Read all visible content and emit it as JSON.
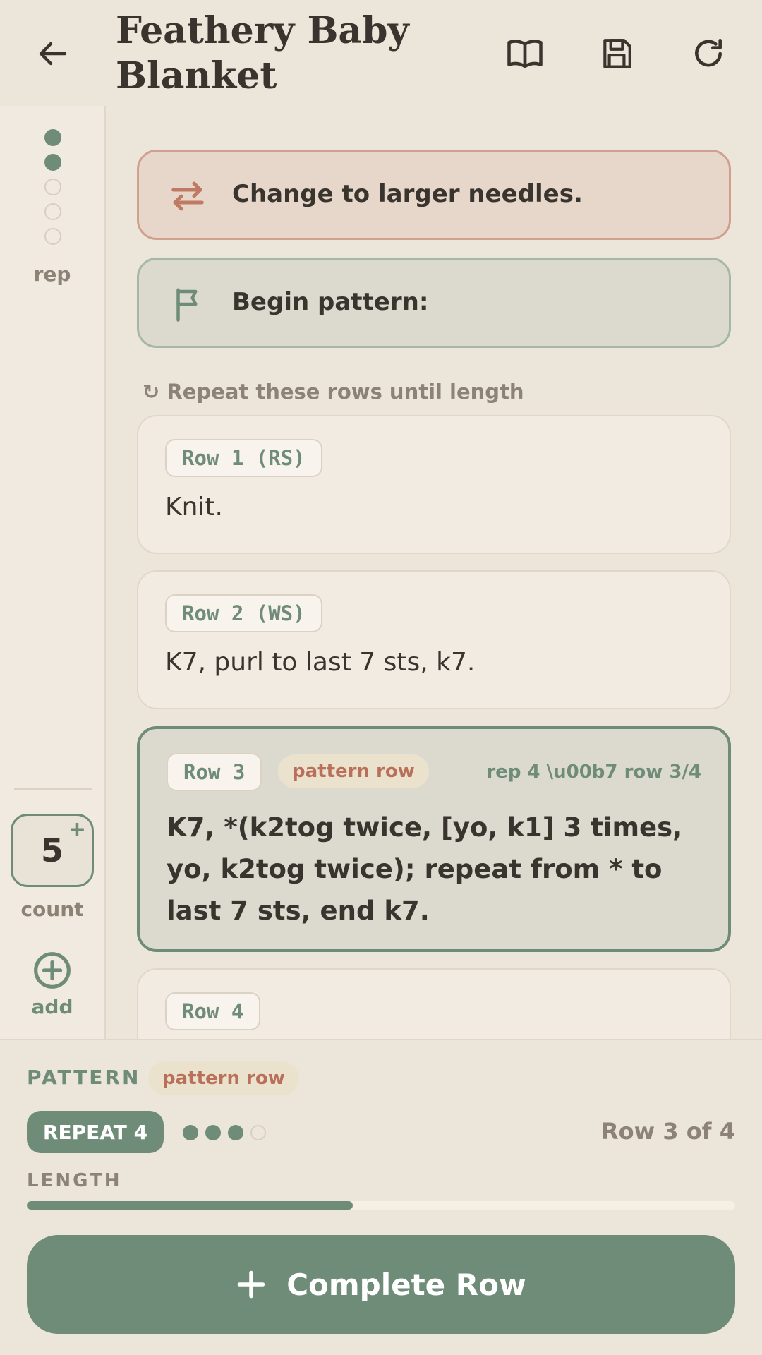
{
  "header": {
    "title": "Feathery Baby Blanket",
    "back_icon": "arrow-left-icon",
    "book_icon": "book-icon",
    "save_icon": "save-icon",
    "reset_icon": "refresh-icon"
  },
  "rail": {
    "dots": [
      true,
      true,
      false,
      false,
      false
    ],
    "rep_label": "rep",
    "count_value": "5",
    "count_plus": "+",
    "count_label": "count",
    "add_label": "add"
  },
  "instructions": {
    "change_text": "Change to larger needles.",
    "begin_text": "Begin pattern:",
    "repeat_note": "↻ Repeat these rows until length"
  },
  "rows": [
    {
      "label": "Row 1 (RS)",
      "text": "Knit."
    },
    {
      "label": "Row 2 (WS)",
      "text": "K7, purl to last 7 sts, k7."
    },
    {
      "label": "Row 3",
      "badge": "pattern row",
      "meta": "rep 4 \\u00b7 row 3/4",
      "text": "K7, *(k2tog twice, [yo, k1] 3 times, yo, k2tog twice); repeat from * to last 7 sts, end k7."
    },
    {
      "label": "Row 4"
    }
  ],
  "bottom": {
    "pattern_label": "PATTERN",
    "pattern_badge": "pattern row",
    "repeat_label": "REPEAT 4",
    "progress_dots": [
      true,
      true,
      true,
      false
    ],
    "row_of": "Row 3 of 4",
    "length_label": "LENGTH",
    "length_progress": 0.46,
    "complete_label": "Complete Row"
  },
  "colors": {
    "accent": "#6f8c79",
    "warning": "#b9705b",
    "background": "#ece5da"
  }
}
